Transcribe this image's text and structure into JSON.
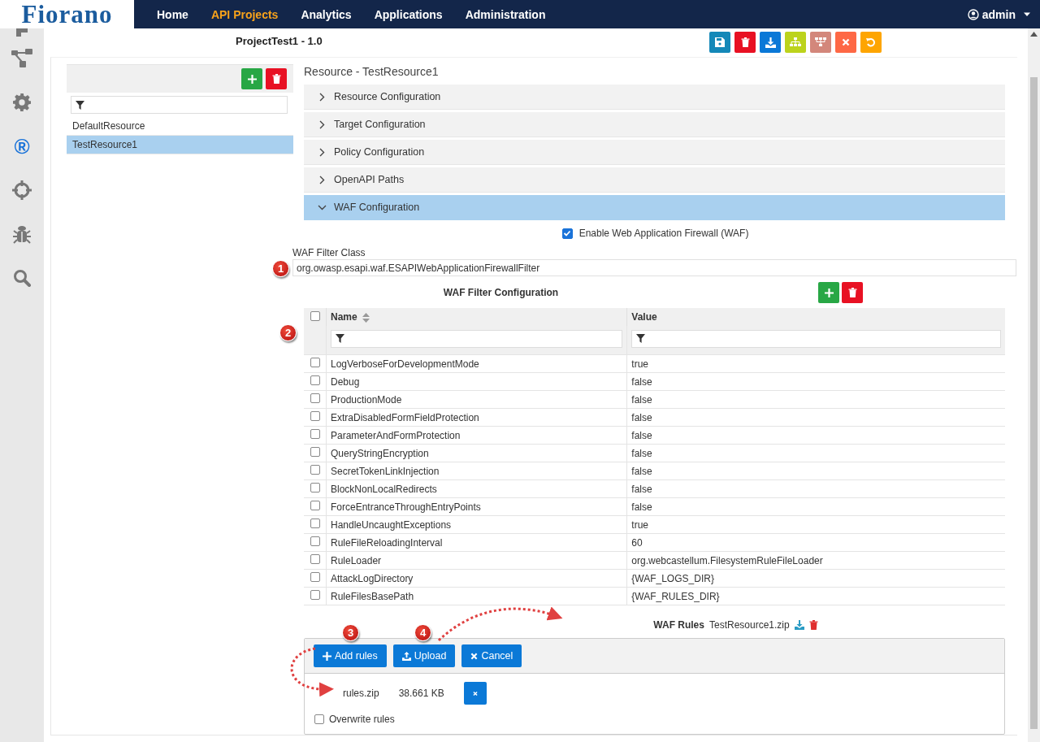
{
  "logo": "Fiorano",
  "nav": [
    {
      "label": "Home",
      "selected": false
    },
    {
      "label": "API Projects",
      "selected": true
    },
    {
      "label": "Analytics",
      "selected": false
    },
    {
      "label": "Applications",
      "selected": false
    },
    {
      "label": "Administration",
      "selected": false
    }
  ],
  "user": {
    "name": "admin"
  },
  "sidebar": [
    {
      "kind": "partial",
      "selected": false
    },
    {
      "kind": "nodes",
      "selected": false
    },
    {
      "kind": "gear",
      "selected": false
    },
    {
      "kind": "glyph",
      "glyph": "®",
      "selected": true
    },
    {
      "kind": "crosshair",
      "selected": false
    },
    {
      "kind": "bug",
      "selected": false
    },
    {
      "kind": "search",
      "selected": false
    }
  ],
  "project_title": "ProjectTest1 - 1.0",
  "toolbar": [
    {
      "kind": "save",
      "color": "#1488b8"
    },
    {
      "kind": "delete",
      "color": "#e81123"
    },
    {
      "kind": "download",
      "color": "#0a78d7"
    },
    {
      "kind": "sitemap",
      "color": "#bcd31c"
    },
    {
      "kind": "hierarchy",
      "color": "#d3877b"
    },
    {
      "kind": "close",
      "color": "#fe6845"
    },
    {
      "kind": "undo",
      "color": "#fea500"
    }
  ],
  "resources": [
    {
      "label": "DefaultResource",
      "selected": false
    },
    {
      "label": "TestResource1",
      "selected": true
    }
  ],
  "resource_title": "Resource - TestResource1",
  "sections": [
    {
      "label": "Resource Configuration",
      "expanded": false
    },
    {
      "label": "Target Configuration",
      "expanded": false
    },
    {
      "label": "Policy Configuration",
      "expanded": false
    },
    {
      "label": "OpenAPI Paths",
      "expanded": false
    },
    {
      "label": "WAF Configuration",
      "expanded": true
    }
  ],
  "enable_waf": {
    "label": "Enable Web Application Firewall (WAF)",
    "checked": true
  },
  "waf_filter_class": {
    "label": "WAF Filter Class",
    "value": "org.owasp.esapi.waf.ESAPIWebApplicationFirewallFilter"
  },
  "filter_config": {
    "title": "WAF Filter Configuration",
    "select_all": false,
    "columns": [
      "Name",
      "Value"
    ],
    "rows": [
      {
        "name": "LogVerboseForDevelopmentMode",
        "value": "true",
        "checked": false
      },
      {
        "name": "Debug",
        "value": "false",
        "checked": false
      },
      {
        "name": "ProductionMode",
        "value": "false",
        "checked": false
      },
      {
        "name": "ExtraDisabledFormFieldProtection",
        "value": "false",
        "checked": false
      },
      {
        "name": "ParameterAndFormProtection",
        "value": "false",
        "checked": false
      },
      {
        "name": "QueryStringEncryption",
        "value": "false",
        "checked": false
      },
      {
        "name": "SecretTokenLinkInjection",
        "value": "false",
        "checked": false
      },
      {
        "name": "BlockNonLocalRedirects",
        "value": "false",
        "checked": false
      },
      {
        "name": "ForceEntranceThroughEntryPoints",
        "value": "false",
        "checked": false
      },
      {
        "name": "HandleUncaughtExceptions",
        "value": "true",
        "checked": false
      },
      {
        "name": "RuleFileReloadingInterval",
        "value": "60",
        "checked": false
      },
      {
        "name": "RuleLoader",
        "value": "org.webcastellum.FilesystemRuleFileLoader",
        "checked": false
      },
      {
        "name": "AttackLogDirectory",
        "value": "{WAF_LOGS_DIR}",
        "checked": false
      },
      {
        "name": "RuleFilesBasePath",
        "value": "{WAF_RULES_DIR}",
        "checked": false
      }
    ]
  },
  "waf_rules": {
    "label": "WAF Rules",
    "file": "TestResource1.zip"
  },
  "upload": {
    "buttons": [
      {
        "kind": "add",
        "label": "Add rules"
      },
      {
        "kind": "upload",
        "label": "Upload"
      },
      {
        "kind": "cancel",
        "label": "Cancel"
      }
    ],
    "file": {
      "name": "rules.zip",
      "size": "38.661 KB"
    },
    "overwrite": {
      "label": "Overwrite rules",
      "checked": false
    }
  },
  "callouts": [
    "1",
    "2",
    "3",
    "4"
  ]
}
